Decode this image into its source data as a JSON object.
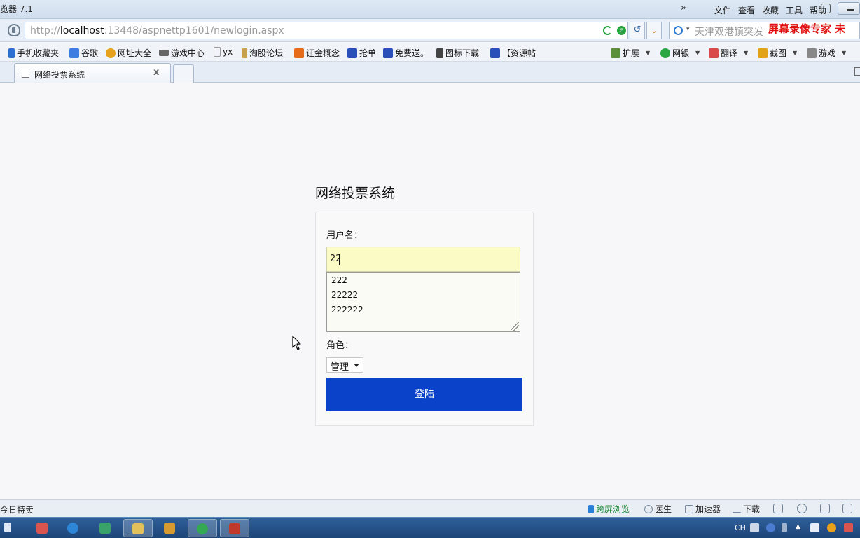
{
  "window": {
    "title": "览器 7.1"
  },
  "menu": {
    "more": "»",
    "items": [
      "文件",
      "查看",
      "收藏",
      "工具",
      "帮助"
    ]
  },
  "address": {
    "url_prefix": "http://",
    "url_host": "localhost",
    "url_rest": ":13448/aspnettp1601/newlogin.aspx",
    "refresh_icon": "↺",
    "dropdown_icon": "⌄"
  },
  "search": {
    "placeholder": "天津双港镇突发",
    "dropdown": "▾"
  },
  "watermark": "屏幕录像专家  未",
  "favorites": [
    {
      "label": "手机收藏夹",
      "icon": "phone-icon",
      "color": "#2d6fd1"
    },
    {
      "label": "谷歌",
      "icon": "google-icon",
      "color": "#3b7de0"
    },
    {
      "label": "网址大全",
      "icon": "globe-icon",
      "color": "#e6a21b"
    },
    {
      "label": "游戏中心",
      "icon": "gamepad-icon",
      "color": "#666666"
    },
    {
      "label": "yx",
      "icon": "page-icon",
      "color": "#bbbbbb"
    },
    {
      "label": "淘股论坛",
      "icon": "pin-icon",
      "color": "#c8a24a"
    },
    {
      "label": "证金概念",
      "icon": "flame-icon",
      "color": "#e66b1a"
    },
    {
      "label": "抢单",
      "icon": "paw-icon",
      "color": "#2a4fb8"
    },
    {
      "label": "免费送。",
      "icon": "paw-icon",
      "color": "#2a4fb8"
    },
    {
      "label": "图标下载",
      "icon": "person-icon",
      "color": "#444444"
    },
    {
      "label": "【资源帖",
      "icon": "paw-icon",
      "color": "#2a4fb8"
    }
  ],
  "tools": [
    {
      "label": "扩展",
      "icon": "grid-icon",
      "color": "#5a8f3c"
    },
    {
      "label": "网银",
      "icon": "yen-icon",
      "color": "#2aa640"
    },
    {
      "label": "翻译",
      "icon": "translate-icon",
      "color": "#d94a4a"
    },
    {
      "label": "截图",
      "icon": "scissors-icon",
      "color": "#e2a31a"
    },
    {
      "label": "游戏",
      "icon": "game-icon",
      "color": "#888888"
    }
  ],
  "tab": {
    "title": "网络投票系统",
    "close": "x"
  },
  "page": {
    "title": "网络投票系统",
    "username_label": "用户名：",
    "username_value": "22",
    "suggestions": [
      "222",
      "22222",
      "222222"
    ],
    "role_label": "角色：",
    "role_value": "管理",
    "login_button": "登陆"
  },
  "status": {
    "text": "今日特卖",
    "items": [
      {
        "label": "跨屏浏览",
        "icon": "phone-icon",
        "color": "#2a7fd6"
      },
      {
        "label": "医生",
        "icon": "doctor-icon",
        "color": "#7a8aa0"
      },
      {
        "label": "加速器",
        "icon": "rocket-icon",
        "color": "#7a8aa0"
      },
      {
        "label": "下载",
        "icon": "download-icon",
        "color": "#7a8aa0"
      }
    ]
  },
  "tray": {
    "lang": "CH"
  }
}
